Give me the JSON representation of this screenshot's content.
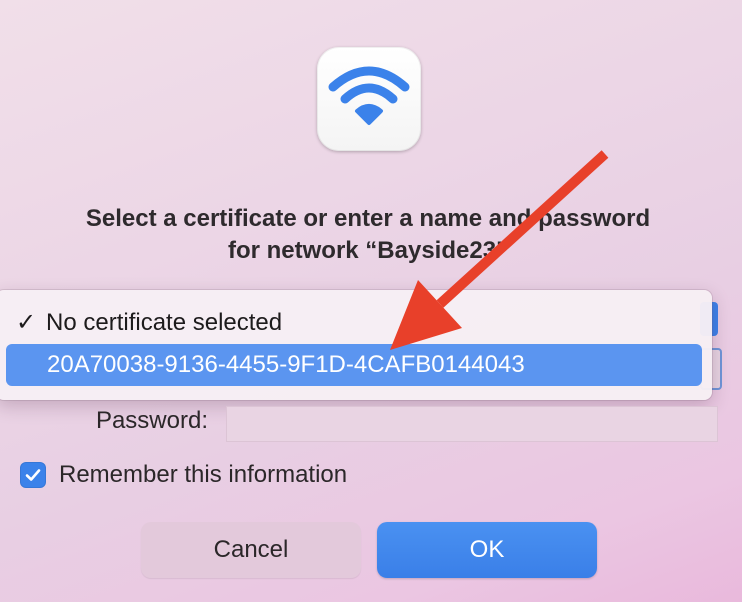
{
  "dialog": {
    "prompt_line_1": "Select a certificate or enter a name and password",
    "prompt_line_2": "for network “Bayside23”"
  },
  "icon": {
    "app_icon": "wifi-icon",
    "accent_color": "#3b82ea"
  },
  "certificate_menu": {
    "items": [
      {
        "label": "No certificate selected",
        "checked": true,
        "highlighted": false
      },
      {
        "label": "20A70038-9136-4455-9F1D-4CAFB0144043",
        "checked": false,
        "highlighted": true
      }
    ],
    "check_glyph": "✓"
  },
  "password": {
    "label": "Password:",
    "value": ""
  },
  "remember": {
    "label": "Remember this information",
    "checked": true
  },
  "buttons": {
    "cancel_label": "Cancel",
    "ok_label": "OK"
  },
  "annotation": {
    "type": "arrow",
    "color": "#e8402a"
  }
}
